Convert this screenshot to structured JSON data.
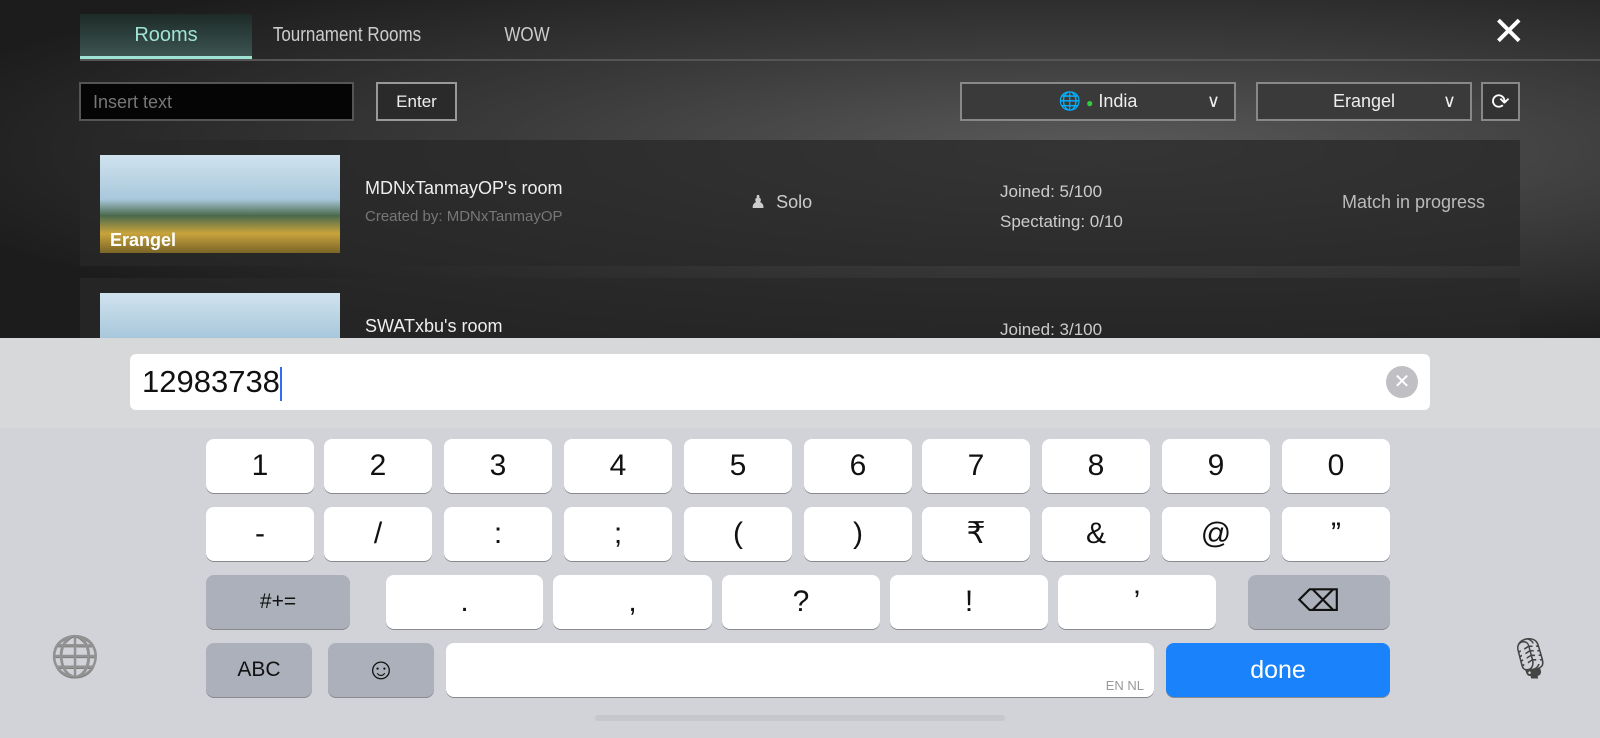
{
  "game": {
    "tabs": [
      {
        "label": "Rooms",
        "active": true
      },
      {
        "label": "Tournament Rooms",
        "active": false
      },
      {
        "label": "WOW",
        "active": false
      }
    ],
    "close_icon": "close-icon",
    "search": {
      "placeholder": "Insert text",
      "enter_label": "Enter"
    },
    "region": {
      "value": "India",
      "icon": "globe-icon",
      "status_color": "#2ecc40"
    },
    "map": {
      "value": "Erangel"
    },
    "refresh_icon": "refresh-icon",
    "rooms": [
      {
        "map": "Erangel",
        "name": "MDNxTanmayOP's room",
        "creator": "Created by: MDNxTanmayOP",
        "mode": "Solo",
        "joined": "Joined: 5/100",
        "spectating": "Spectating: 0/10",
        "status": "Match in progress"
      },
      {
        "name": "SWATxbu's room",
        "joined": "Joined: 3/100"
      }
    ],
    "accent": "#9fe3d4"
  },
  "keyboard": {
    "input_value": "12983738",
    "row1": [
      "1",
      "2",
      "3",
      "4",
      "5",
      "6",
      "7",
      "8",
      "9",
      "0"
    ],
    "row2": [
      "-",
      "/",
      ":",
      ";",
      "(",
      ")",
      "₹",
      "&",
      "@",
      "”"
    ],
    "row3": {
      "mode": "#+=",
      "keys": [
        ".",
        ",",
        "?",
        "!",
        "’"
      ]
    },
    "abc": "ABC",
    "space_lang": "EN NL",
    "done": "done",
    "done_color": "#1a82fb"
  }
}
